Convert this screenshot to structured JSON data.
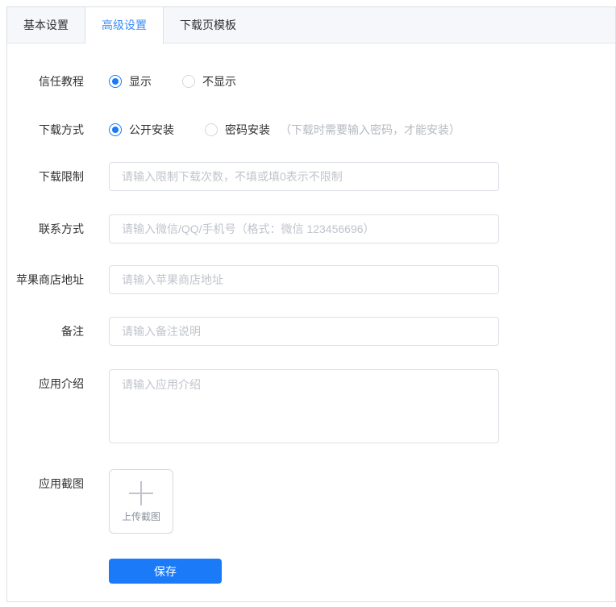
{
  "tabs": {
    "items": [
      {
        "label": "基本设置",
        "active": false
      },
      {
        "label": "高级设置",
        "active": true
      },
      {
        "label": "下载页模板",
        "active": false
      }
    ]
  },
  "form": {
    "trust_tutorial": {
      "label": "信任教程",
      "options": [
        {
          "label": "显示",
          "selected": true
        },
        {
          "label": "不显示",
          "selected": false
        }
      ]
    },
    "download_method": {
      "label": "下载方式",
      "options": [
        {
          "label": "公开安装",
          "selected": true
        },
        {
          "label": "密码安装",
          "selected": false
        }
      ],
      "password_note": "（下载时需要输入密码，才能安装）"
    },
    "download_limit": {
      "label": "下载限制",
      "placeholder": "请输入限制下载次数，不填或填0表示不限制",
      "value": ""
    },
    "contact": {
      "label": "联系方式",
      "placeholder": "请输入微信/QQ/手机号（格式：微信 123456696）",
      "value": ""
    },
    "apple_store": {
      "label": "苹果商店地址",
      "placeholder": "请输入苹果商店地址",
      "value": ""
    },
    "remark": {
      "label": "备注",
      "placeholder": "请输入备注说明",
      "value": ""
    },
    "app_intro": {
      "label": "应用介绍",
      "placeholder": "请输入应用介绍",
      "value": ""
    },
    "app_screenshot": {
      "label": "应用截图",
      "upload_text": "上传截图"
    },
    "save_button": "保存"
  },
  "colors": {
    "accent": "#1a7af8",
    "tab_active_text": "#3e8ef7",
    "tabs_header_bg": "#f5f7fa",
    "card_border": "#dcdfe6",
    "input_border": "#dcdfe6",
    "placeholder_text": "#c0c4cc",
    "note_text": "#b6bac1",
    "label_text": "#303133"
  }
}
